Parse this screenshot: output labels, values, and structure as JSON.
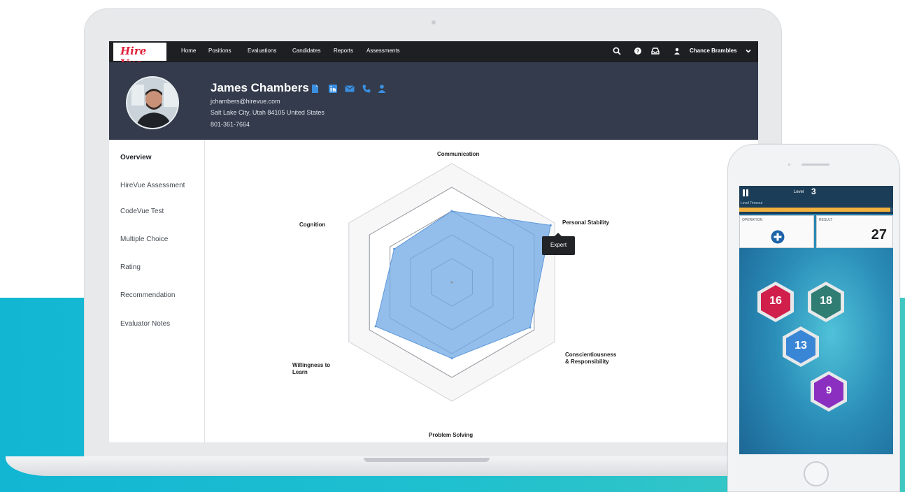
{
  "app": {
    "logo_text": "Hire Vue",
    "nav_links": [
      "Home",
      "Positions",
      "Evaluations",
      "Candidates",
      "Reports",
      "Assessments"
    ],
    "nav_icons": [
      "search-icon",
      "help-icon",
      "inbox-icon",
      "user-icon"
    ],
    "user_name": "Chance Brambles"
  },
  "profile": {
    "name": "James Chambers",
    "email": "jchambers@hirevue.com",
    "address": "Salt Lake City, Utah 84105 United States",
    "phone": "801-361-7664",
    "action_icons": [
      "document-icon",
      "linkedin-icon",
      "email-icon",
      "phone-icon",
      "person-icon"
    ],
    "accent_color": "#3a8fe0"
  },
  "sidebar": {
    "items": [
      {
        "label": "Overview",
        "active": true
      },
      {
        "label": "HireVue Assessment",
        "active": false
      },
      {
        "label": "CodeVue Test",
        "active": false
      },
      {
        "label": "Multiple Choice",
        "active": false
      },
      {
        "label": "Rating",
        "active": false
      },
      {
        "label": "Recommendation",
        "active": false
      },
      {
        "label": "Evaluator Notes",
        "active": false
      }
    ]
  },
  "chart_data": {
    "type": "radar",
    "axes": [
      "Communication",
      "Personal Stability",
      "Conscientiousness & Responsibility",
      "Problem Solving",
      "Willingness to Learn",
      "Cognition"
    ],
    "levels": 5,
    "values": [
      3.0,
      4.8,
      3.8,
      3.2,
      3.7,
      2.8
    ],
    "fill_color": "#6fa8e6",
    "tooltip": "Expert"
  },
  "game": {
    "level_label": "Level",
    "level_value": "3",
    "timeout_label": "Level Timeout",
    "timeout_progress": 0.98,
    "operation_label": "OPERATION",
    "result_label": "RESULT",
    "result_value": "27",
    "tiles": [
      {
        "value": "16",
        "color": "#d11f4c"
      },
      {
        "value": "18",
        "color": "#2f7d73"
      },
      {
        "value": "13",
        "color": "#3a86d6"
      },
      {
        "value": "9",
        "color": "#8a2fc0"
      }
    ]
  }
}
